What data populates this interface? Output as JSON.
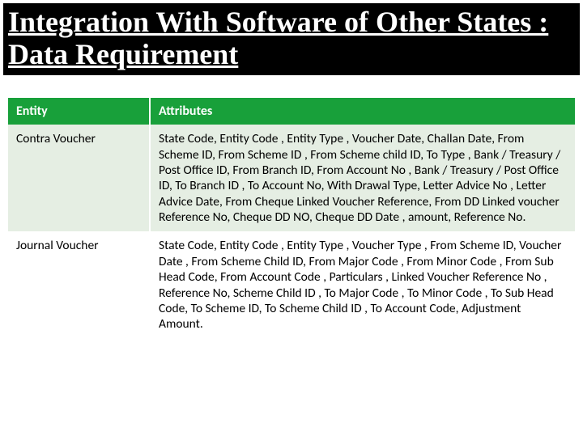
{
  "title": "Integration With Software of Other States : Data Requirement",
  "table": {
    "headers": {
      "entity": "Entity",
      "attributes": "Attributes"
    },
    "rows": [
      {
        "entity": "Contra Voucher",
        "attributes": "State Code, Entity Code , Entity Type , Voucher Date, Challan  Date, From Scheme ID, From  Scheme ID , From Scheme child ID, To Type , Bank / Treasury / Post Office  ID, From Branch ID, From Account No , Bank / Treasury / Post Office  ID, To Branch ID , To  Account No, With Drawal  Type, Letter Advice No , Letter Advice  Date, From Cheque Linked Voucher Reference, From  DD Linked voucher Reference No, Cheque DD NO, Cheque DD Date , amount, Reference No."
      },
      {
        "entity": "Journal Voucher",
        "attributes": "State Code, Entity Code , Entity Type , Voucher Type , From Scheme ID, Voucher Date , From Scheme Child ID, From  Major Code , From Minor Code , From  Sub Head Code, From  Account Code , Particulars , Linked Voucher Reference No , Reference  No, Scheme Child ID , To Major Code , To Minor Code , To Sub Head Code, To Scheme ID, To Scheme Child ID , To Account Code, Adjustment Amount."
      }
    ]
  }
}
